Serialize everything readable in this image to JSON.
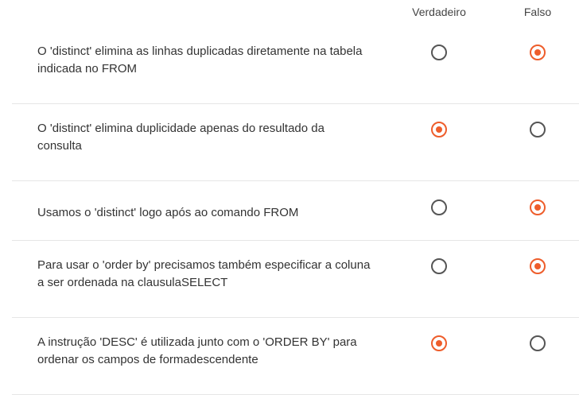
{
  "columns": {
    "true_label": "Verdadeiro",
    "false_label": "Falso"
  },
  "colors": {
    "selected": "#ee5d2b",
    "unselected": "#555555",
    "divider": "#e6e6e6"
  },
  "rows": [
    {
      "text": "O 'distinct' elimina as linhas duplicadas diretamente na tabela indicada no FROM",
      "selected": "false"
    },
    {
      "text": "O 'distinct' elimina duplicidade apenas do resultado da consulta",
      "selected": "true"
    },
    {
      "text": "Usamos o 'distinct' logo após ao comando FROM",
      "selected": "false"
    },
    {
      "text": "Para usar o 'order by' precisamos também especificar a coluna a ser ordenada na clausulaSELECT",
      "selected": "false"
    },
    {
      "text": "A instrução 'DESC' é utilizada junto com o 'ORDER BY' para ordenar os campos de formadescendente",
      "selected": "true"
    }
  ]
}
